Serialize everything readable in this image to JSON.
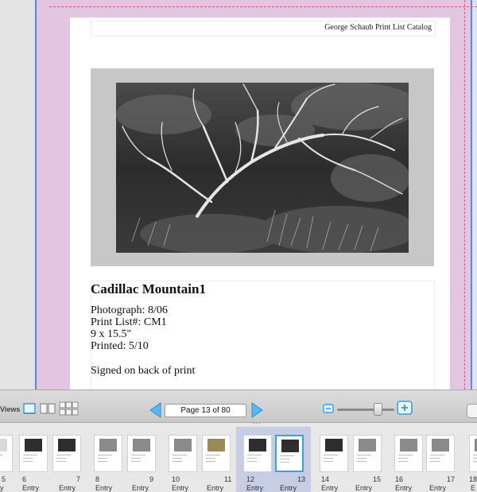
{
  "document": {
    "header": "George Schaub Print List Catalog",
    "entry_title": "Cadillac Mountain1",
    "lines": [
      "Photograph: 8/06",
      "Print List#: CM1",
      "9 x 15.5\"",
      "Printed: 5/10"
    ],
    "note": "Signed on back of print"
  },
  "toolbar": {
    "views_label": "Views",
    "page_indicator": "Page 13 of 80"
  },
  "strip": {
    "handle": "...",
    "selected_pages": [
      12,
      13
    ],
    "thumbs": [
      {
        "num": "5",
        "label": "y",
        "photo": "none"
      },
      {
        "num": "6",
        "label": "Entry",
        "photo": "dark"
      },
      {
        "num": "7",
        "label": "Entry",
        "photo": "dark"
      },
      {
        "num": "8",
        "label": "Entry",
        "photo": "grey"
      },
      {
        "num": "9",
        "label": "Entry",
        "photo": "grey"
      },
      {
        "num": "10",
        "label": "Entry",
        "photo": "grey"
      },
      {
        "num": "11",
        "label": "Entry",
        "photo": "tan"
      },
      {
        "num": "12",
        "label": "Entry",
        "photo": "dark"
      },
      {
        "num": "13",
        "label": "Entry",
        "photo": "dark"
      },
      {
        "num": "14",
        "label": "Entry",
        "photo": "dark"
      },
      {
        "num": "15",
        "label": "Entry",
        "photo": "grey"
      },
      {
        "num": "16",
        "label": "Entry",
        "photo": "grey"
      },
      {
        "num": "17",
        "label": "Entry",
        "photo": "grey"
      },
      {
        "num": "18",
        "label": "E",
        "photo": "grey"
      }
    ]
  },
  "colors": {
    "spread_background": "#e3c4e1",
    "selection_accent": "#3aa0e6",
    "selected_band": "#c6cde4"
  }
}
